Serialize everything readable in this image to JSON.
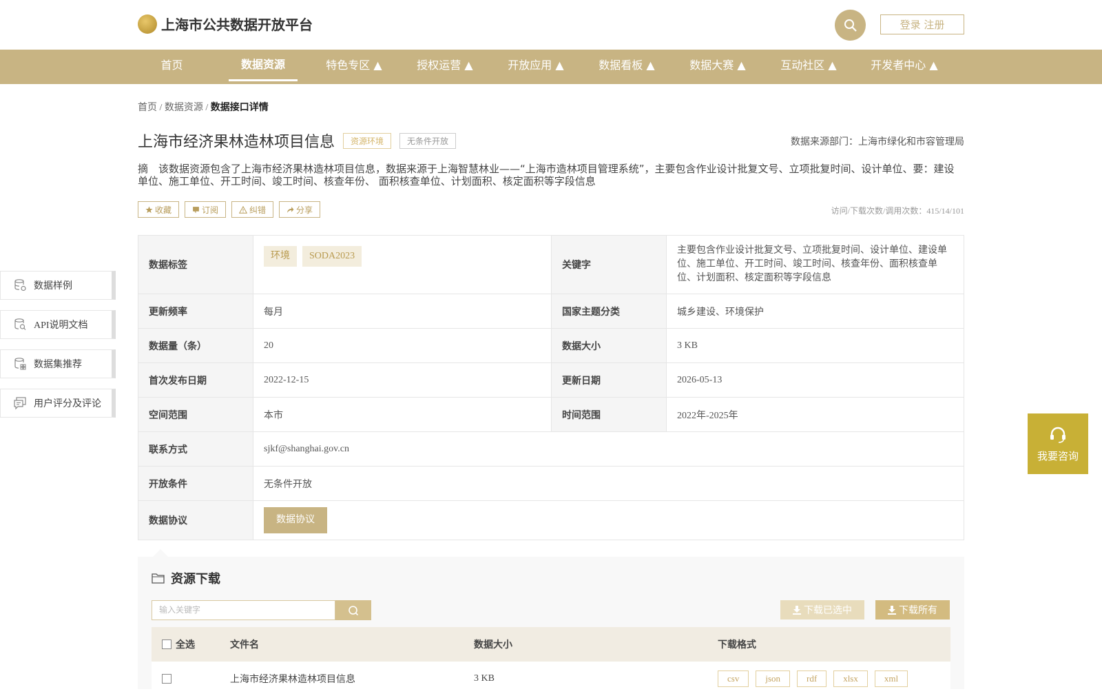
{
  "header": {
    "site_title": "上海市公共数据开放平台",
    "login_label": "登录 注册"
  },
  "nav": {
    "items": [
      {
        "label": "首页"
      },
      {
        "label": "数据资源"
      },
      {
        "label": "特色专区 ▲"
      },
      {
        "label": "授权运营 ▲"
      },
      {
        "label": "开放应用 ▲"
      },
      {
        "label": "数据看板 ▲"
      },
      {
        "label": "数据大赛 ▲"
      },
      {
        "label": "互动社区 ▲"
      },
      {
        "label": "开发者中心 ▲"
      }
    ],
    "active_index": 1
  },
  "breadcrumb": {
    "home": "首页",
    "sep": "/",
    "section": "数据资源",
    "current": "数据接口详情"
  },
  "dataset": {
    "title": "上海市经济果林造林项目信息",
    "category_tag": "资源环境",
    "open_tag": "无条件开放",
    "source_dept": "数据来源部门：上海市绿化和市容管理局",
    "abstract": "摘　该数据资源包含了上海市经济果林造林项目信息，数据来源于上海智慧林业——“上海市造林项目管理系统”，主要包含作业设计批复文号、立项批复时间、设计单位、要：建设单位、施工单位、开工时间、竣工时间、核查年份、 面积核查单位、计划面积、核定面积等字段信息",
    "actions": [
      "收藏",
      "订阅",
      "纠错",
      "分享"
    ],
    "stats": "访问/下载次数/调用次数：415/14/101"
  },
  "info": {
    "tags_label": "数据标签",
    "tags": [
      "环境",
      "SODA2023"
    ],
    "keywords_label": "关键字",
    "keywords": "主要包含作业设计批复文号、立项批复时间、设计单位、建设单位、施工单位、开工时间、竣工时间、核查年份、面积核查单位、计划面积、核定面积等字段信息",
    "freq_label": "更新频率",
    "freq": "每月",
    "theme_label": "国家主题分类",
    "theme": "城乡建设、环境保护",
    "count_label": "数据量（条）",
    "count": "20",
    "size_label": "数据大小",
    "size": "3 KB",
    "first_pub_label": "首次发布日期",
    "first_pub": "2022-12-15",
    "updated_label": "更新日期",
    "updated": "2026-05-13",
    "space_label": "空间范围",
    "space": "本市",
    "time_label": "时间范围",
    "time": "2022年-2025年",
    "contact_label": "联系方式",
    "contact": "sjkf@shanghai.gov.cn",
    "condition_label": "开放条件",
    "condition": "无条件开放",
    "agreement_label": "数据协议",
    "agreement_button": "数据协议"
  },
  "side_nav": [
    {
      "label": "数据样例",
      "icon": "database-icon"
    },
    {
      "label": "API说明文档",
      "icon": "database-search-icon"
    },
    {
      "label": "数据集推荐",
      "icon": "database-grid-icon"
    },
    {
      "label": "用户评分及评论",
      "icon": "comment-icon"
    }
  ],
  "consult": {
    "label": "我要咨询"
  },
  "download": {
    "title": "资源下载",
    "search_placeholder": "输入关键字",
    "download_selected": "下载已选中",
    "download_all": "下载所有",
    "headers": {
      "select_all": "全选",
      "filename": "文件名",
      "size": "数据大小",
      "formats": "下载格式"
    },
    "rows": [
      {
        "filename": "上海市经济果林造林项目信息",
        "size": "3 KB",
        "formats": [
          "csv",
          "json",
          "rdf",
          "xlsx",
          "xml"
        ]
      }
    ]
  },
  "colors": {
    "accent": "#c8b483",
    "consult": "#c8b036"
  }
}
